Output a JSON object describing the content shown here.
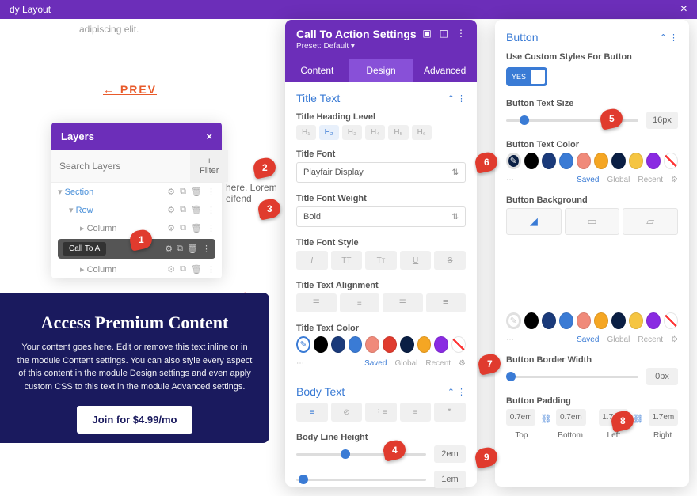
{
  "topbar": {
    "title": "dy Layout"
  },
  "lorem": "adipiscing elit.",
  "prev_link": "← PREV",
  "extra_text": "here. Lorem\neifend",
  "layers": {
    "title": "Layers",
    "search_ph": "Search Layers",
    "filter": "+ Filter",
    "section": "Section",
    "row": "Row",
    "column": "Column",
    "cta": "Call To A"
  },
  "hero": {
    "title": "Access Premium Content",
    "body": "Your content goes here. Edit or remove this text inline or in the module Content settings. You can also style every aspect of this content in the module Design settings and even apply custom CSS to this text in the module Advanced settings.",
    "btn": "Join for $4.99/mo"
  },
  "p1": {
    "title": "Call To Action Settings",
    "preset": "Preset: Default ▾",
    "tabs": {
      "content": "Content",
      "design": "Design",
      "advanced": "Advanced"
    },
    "title_text": "Title Text",
    "heading_lbl": "Title Heading Level",
    "h": [
      "H₁",
      "H₂",
      "H₃",
      "H₄",
      "H₅",
      "H₆"
    ],
    "font_lbl": "Title Font",
    "font_val": "Playfair Display",
    "weight_lbl": "Title Font Weight",
    "weight_val": "Bold",
    "style_lbl": "Title Font Style",
    "align_lbl": "Title Text Alignment",
    "color_lbl": "Title Text Color",
    "body_text": "Body Text",
    "blh_lbl": "Body Line Height",
    "blh_val": "2em",
    "blh_val2": "1em",
    "saved": "Saved",
    "global": "Global",
    "recent": "Recent"
  },
  "p2": {
    "button": "Button",
    "custom_lbl": "Use Custom Styles For Button",
    "yes": "YES",
    "size_lbl": "Button Text Size",
    "size_val": "16px",
    "color_lbl": "Button Text Color",
    "bg_lbl": "Button Background",
    "border_lbl": "Button Border Width",
    "border_val": "0px",
    "padding_lbl": "Button Padding",
    "pad": {
      "t": "0.7em",
      "b": "0.7em",
      "l": "1.7em",
      "r": "1.7em",
      "tl": "Top",
      "bl": "Bottom",
      "ll": "Left",
      "rl": "Right"
    },
    "saved": "Saved",
    "global": "Global",
    "recent": "Recent"
  },
  "colors": {
    "black": "#000",
    "navy": "#1a3a7a",
    "blue": "#3a7bd5",
    "coral": "#f08a7a",
    "red": "#e03b2e",
    "dnavy": "#0a1f44",
    "orange": "#f5a623",
    "slate": "#4a5568",
    "yellow": "#f5c542",
    "purple": "#8a2be2"
  }
}
